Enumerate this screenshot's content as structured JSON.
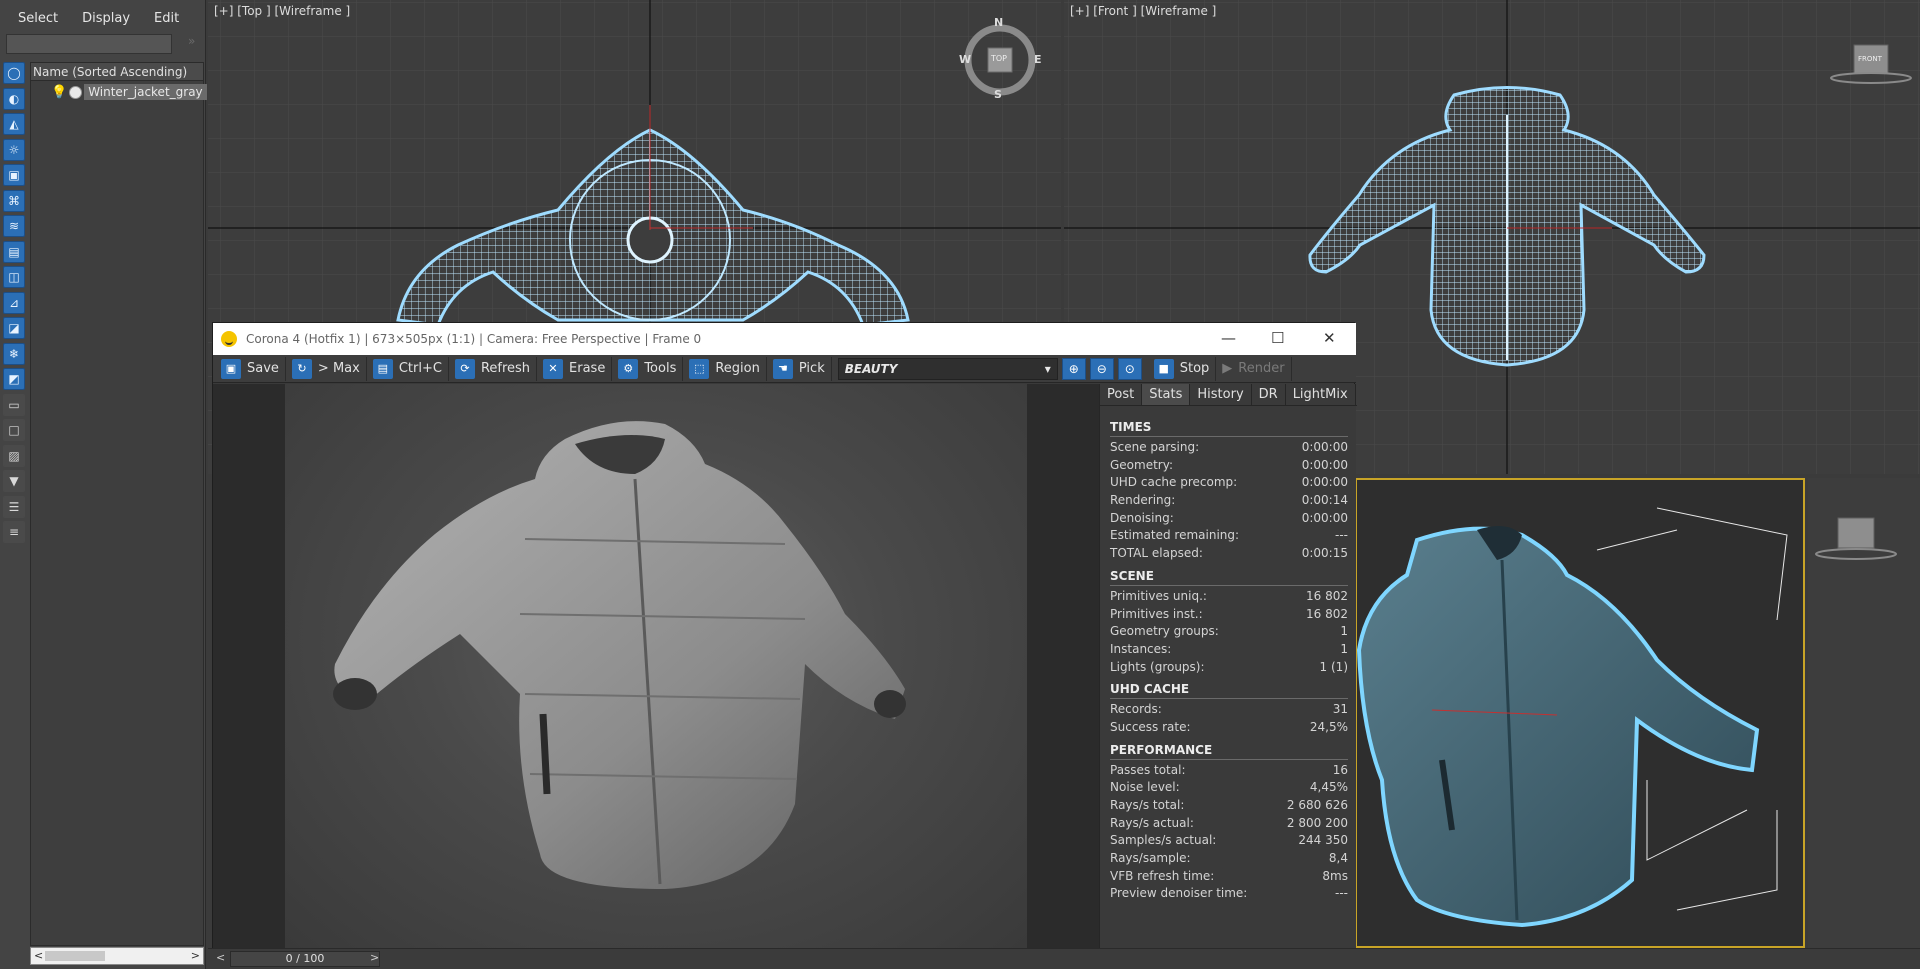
{
  "explorer": {
    "menu": [
      "Select",
      "Display",
      "Edit"
    ],
    "list_header": "Name (Sorted Ascending)",
    "object_name": "Winter_jacket_gray"
  },
  "viewports": {
    "top_label": "[+] [Top ] [Wireframe ]",
    "front_label": "[+] [Front ] [Wireframe ]",
    "compass": {
      "n": "N",
      "s": "S",
      "e": "E",
      "w": "W",
      "center": "TOP"
    },
    "viewcube_front": "FRONT"
  },
  "vfb": {
    "title": "Corona 4 (Hotfix 1) | 673×505px (1:1) | Camera: Free Perspective | Frame 0",
    "toolbar": {
      "save": "Save",
      "to_max": "> Max",
      "copy": "Ctrl+C",
      "refresh": "Refresh",
      "erase": "Erase",
      "tools": "Tools",
      "region": "Region",
      "pick": "Pick",
      "channel": "BEAUTY",
      "stop": "Stop",
      "render": "Render"
    },
    "tabs": [
      "Post",
      "Stats",
      "History",
      "DR",
      "LightMix"
    ],
    "stats": {
      "times": {
        "title": "TIMES",
        "rows": [
          {
            "label": "Scene parsing:",
            "value": "0:00:00"
          },
          {
            "label": "Geometry:",
            "value": "0:00:00"
          },
          {
            "label": "UHD cache precomp:",
            "value": "0:00:00"
          },
          {
            "label": "Rendering:",
            "value": "0:00:14"
          },
          {
            "label": "Denoising:",
            "value": "0:00:00"
          },
          {
            "label": "Estimated remaining:",
            "value": "---"
          },
          {
            "label": "TOTAL elapsed:",
            "value": "0:00:15"
          }
        ]
      },
      "scene": {
        "title": "SCENE",
        "rows": [
          {
            "label": "Primitives uniq.:",
            "value": "16 802"
          },
          {
            "label": "Primitives inst.:",
            "value": "16 802"
          },
          {
            "label": "Geometry groups:",
            "value": "1"
          },
          {
            "label": "Instances:",
            "value": "1"
          },
          {
            "label": "Lights (groups):",
            "value": "1 (1)"
          }
        ]
      },
      "uhd": {
        "title": "UHD CACHE",
        "rows": [
          {
            "label": "Records:",
            "value": "31"
          },
          {
            "label": "Success rate:",
            "value": "24,5%"
          }
        ]
      },
      "performance": {
        "title": "PERFORMANCE",
        "rows": [
          {
            "label": "Passes total:",
            "value": "16"
          },
          {
            "label": "Noise level:",
            "value": "4,45%"
          },
          {
            "label": "Rays/s total:",
            "value": "2 680 626"
          },
          {
            "label": "Rays/s actual:",
            "value": "2 800 200"
          },
          {
            "label": "Samples/s actual:",
            "value": "244 350"
          },
          {
            "label": "Rays/sample:",
            "value": "8,4"
          },
          {
            "label": "VFB refresh time:",
            "value": "8ms"
          },
          {
            "label": "Preview denoiser time:",
            "value": "---"
          }
        ]
      }
    }
  },
  "timebar": {
    "frame": "0 / 100"
  },
  "colors": {
    "accent_blue": "#2b6fb6",
    "wire": "#bfe8ff",
    "active_viewport": "#c8a427"
  }
}
